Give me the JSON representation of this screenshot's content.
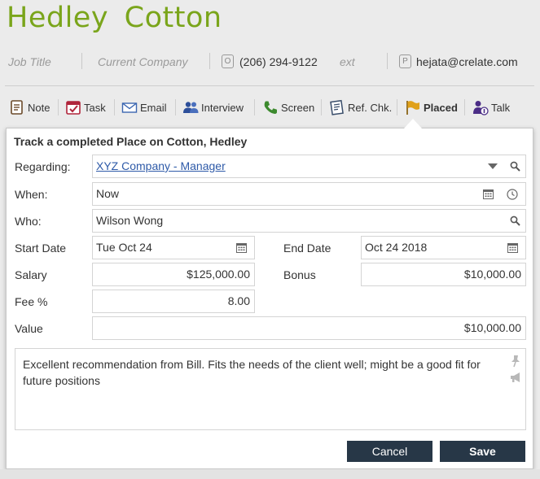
{
  "person": {
    "name": "Hedley  Cotton"
  },
  "contact": {
    "job_title_placeholder": "Job Title",
    "company_placeholder": "Current Company",
    "phone": "(206) 294-9122",
    "ext_placeholder": "ext",
    "email": "hejata@crelate.com",
    "phone_icon_glyph": "O",
    "email_icon_glyph": "P"
  },
  "actions": [
    {
      "label": "Note",
      "icon": "note-icon"
    },
    {
      "label": "Task",
      "icon": "task-icon"
    },
    {
      "label": "Email",
      "icon": "email-icon"
    },
    {
      "label": "Interview",
      "icon": "interview-icon"
    },
    {
      "label": "Screen",
      "icon": "phone-icon"
    },
    {
      "label": "Ref. Chk.",
      "icon": "reference-check-icon"
    },
    {
      "label": "Placed",
      "icon": "flag-icon",
      "active": true
    },
    {
      "label": "Talk",
      "icon": "talk-icon"
    }
  ],
  "form": {
    "title": "Track a completed Place on Cotton, Hedley",
    "regarding_label": "Regarding:",
    "regarding_value": "XYZ Company - Manager",
    "when_label": "When:",
    "when_value": "Now",
    "who_label": "Who:",
    "who_value": "Wilson Wong",
    "start_date_label": "Start Date",
    "start_date_value": "Tue Oct 24",
    "end_date_label": "End Date",
    "end_date_value": "Oct 24 2018",
    "salary_label": "Salary",
    "salary_value": "$125,000.00",
    "bonus_label": "Bonus",
    "bonus_value": "$10,000.00",
    "fee_label": "Fee %",
    "fee_value": "8.00",
    "value_label": "Value",
    "value_value": "$10,000.00",
    "notes": "Excellent recommendation from Bill. Fits the needs of the client well; might be a good fit for future positions",
    "cancel_label": "Cancel",
    "save_label": "Save"
  },
  "colors": {
    "name_green": "#7aa51b",
    "button_dark": "#273747",
    "link_blue": "#2e5aa8",
    "flag_orange": "#e0a11b"
  }
}
